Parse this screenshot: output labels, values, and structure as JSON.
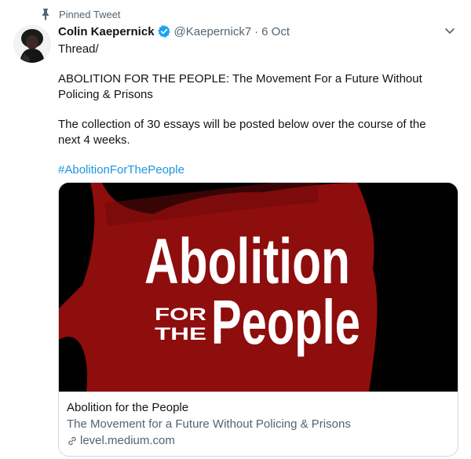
{
  "pinned_label": "Pinned Tweet",
  "author": {
    "name": "Colin Kaepernick",
    "handle": "@Kaepernick7",
    "separator": "·",
    "date": "6 Oct"
  },
  "tweet": {
    "line1": "Thread/",
    "line2": "ABOLITION FOR THE PEOPLE: The Movement For a Future Without Policing & Prisons",
    "line3": "The collection of 30 essays will be posted below over the course of the next 4 weeks.",
    "hashtag": "#AbolitionForThePeople"
  },
  "card": {
    "image_text": {
      "word1": "Abolition",
      "small_line1": "FOR",
      "small_line2": "THE",
      "word2": "People"
    },
    "title": "Abolition for the People",
    "description": "The Movement for a Future Without Policing & Prisons",
    "domain": "level.medium.com"
  },
  "icons": {
    "pin": "pin-icon",
    "verified": "verified-badge-icon",
    "chevron": "chevron-down-icon",
    "link": "link-icon"
  },
  "colors": {
    "link": "#1b95e0",
    "verified": "#1da1f2",
    "image_red": "#8e0d0d"
  }
}
